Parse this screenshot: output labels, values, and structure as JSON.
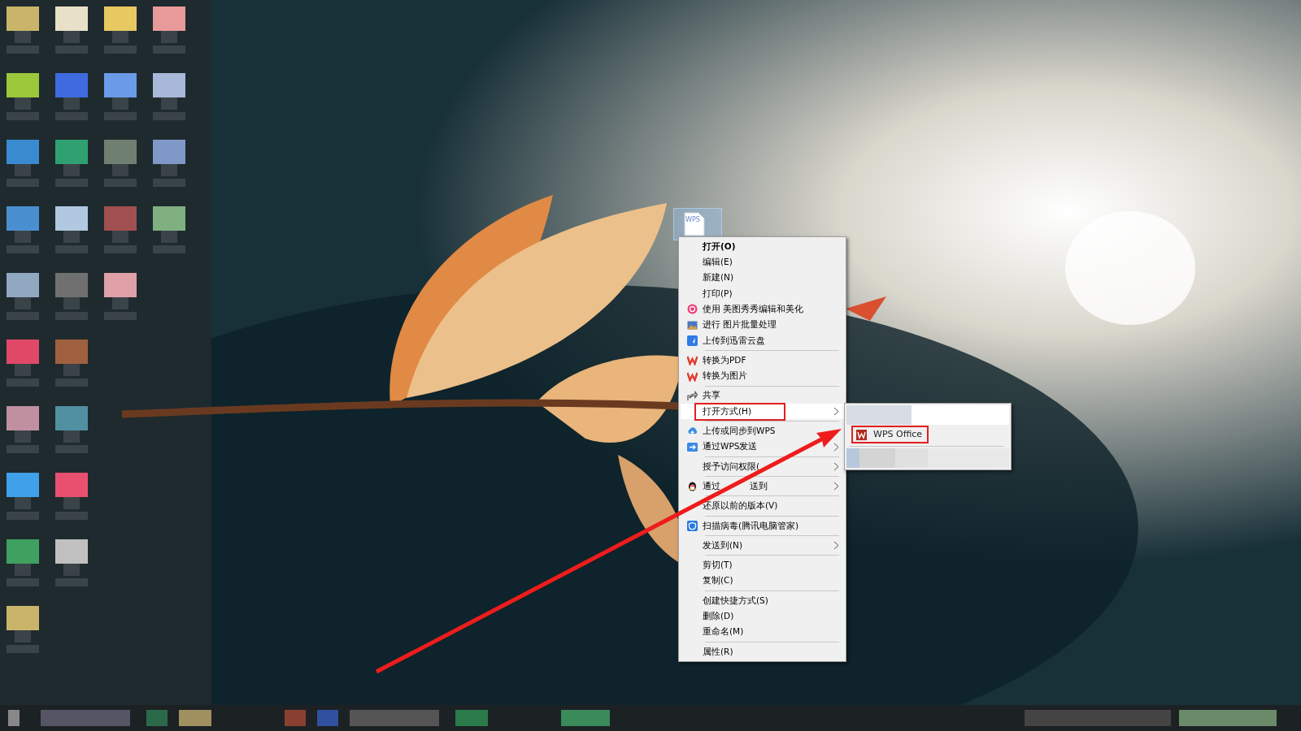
{
  "desktop_file": {
    "type_label": "WPS",
    "selected": true
  },
  "context_menu": {
    "items": [
      {
        "kind": "item",
        "label": "打开(O)",
        "default": true,
        "submenu": false,
        "highlighted": false,
        "annotated": false
      },
      {
        "kind": "item",
        "label": "编辑(E)",
        "default": false,
        "submenu": false,
        "highlighted": false,
        "annotated": false
      },
      {
        "kind": "item",
        "label": "新建(N)",
        "default": false,
        "submenu": false,
        "highlighted": false,
        "annotated": false
      },
      {
        "kind": "item",
        "label": "打印(P)",
        "default": false,
        "submenu": false,
        "highlighted": false,
        "annotated": false
      },
      {
        "kind": "item",
        "label": "使用 美图秀秀编辑和美化",
        "default": false,
        "submenu": false,
        "highlighted": false,
        "annotated": false
      },
      {
        "kind": "item",
        "label": "进行 图片批量处理",
        "default": false,
        "submenu": false,
        "highlighted": false,
        "annotated": false
      },
      {
        "kind": "item",
        "label": "上传到迅雷云盘",
        "default": false,
        "submenu": false,
        "highlighted": false,
        "annotated": false
      },
      {
        "kind": "separator"
      },
      {
        "kind": "item",
        "label": "转换为PDF",
        "default": false,
        "submenu": false,
        "highlighted": false,
        "annotated": false
      },
      {
        "kind": "item",
        "label": "转换为图片",
        "default": false,
        "submenu": false,
        "highlighted": false,
        "annotated": false
      },
      {
        "kind": "separator"
      },
      {
        "kind": "item",
        "label": "共享",
        "default": false,
        "submenu": false,
        "highlighted": false,
        "annotated": false
      },
      {
        "kind": "item",
        "label": "打开方式(H)",
        "default": false,
        "submenu": true,
        "highlighted": true,
        "annotated": true
      },
      {
        "kind": "separator"
      },
      {
        "kind": "item",
        "label": "上传或同步到WPS",
        "default": false,
        "submenu": false,
        "highlighted": false,
        "annotated": false
      },
      {
        "kind": "item",
        "label": "通过WPS发送",
        "default": false,
        "submenu": true,
        "highlighted": false,
        "annotated": false
      },
      {
        "kind": "separator"
      },
      {
        "kind": "item",
        "label": "授予访问权限(",
        "default": false,
        "submenu": true,
        "highlighted": false,
        "annotated": false
      },
      {
        "kind": "separator"
      },
      {
        "kind": "item",
        "label": "通过",
        "label_tail": "送到",
        "default": false,
        "submenu": true,
        "highlighted": false,
        "annotated": false
      },
      {
        "kind": "separator"
      },
      {
        "kind": "item",
        "label": "还原以前的版本(V)",
        "default": false,
        "submenu": false,
        "highlighted": false,
        "annotated": false
      },
      {
        "kind": "separator"
      },
      {
        "kind": "item",
        "label": "扫描病毒(腾讯电脑管家)",
        "default": false,
        "submenu": false,
        "highlighted": false,
        "annotated": false
      },
      {
        "kind": "separator"
      },
      {
        "kind": "item",
        "label": "发送到(N)",
        "default": false,
        "submenu": true,
        "highlighted": false,
        "annotated": false
      },
      {
        "kind": "separator"
      },
      {
        "kind": "item",
        "label": "剪切(T)",
        "default": false,
        "submenu": false,
        "highlighted": false,
        "annotated": false
      },
      {
        "kind": "item",
        "label": "复制(C)",
        "default": false,
        "submenu": false,
        "highlighted": false,
        "annotated": false
      },
      {
        "kind": "separator"
      },
      {
        "kind": "item",
        "label": "创建快捷方式(S)",
        "default": false,
        "submenu": false,
        "highlighted": false,
        "annotated": false
      },
      {
        "kind": "item",
        "label": "删除(D)",
        "default": false,
        "submenu": false,
        "highlighted": false,
        "annotated": false
      },
      {
        "kind": "item",
        "label": "重命名(M)",
        "default": false,
        "submenu": false,
        "highlighted": false,
        "annotated": false
      },
      {
        "kind": "separator"
      },
      {
        "kind": "item",
        "label": "属性(R)",
        "default": false,
        "submenu": false,
        "highlighted": false,
        "annotated": false
      }
    ]
  },
  "open_with_submenu": {
    "items": [
      {
        "kind": "blurred",
        "highlighted": true,
        "annotated": false
      },
      {
        "kind": "app",
        "label": "WPS Office",
        "highlighted": false,
        "annotated": true
      },
      {
        "kind": "separator"
      },
      {
        "kind": "blurred",
        "highlighted": false,
        "annotated": false
      }
    ]
  }
}
